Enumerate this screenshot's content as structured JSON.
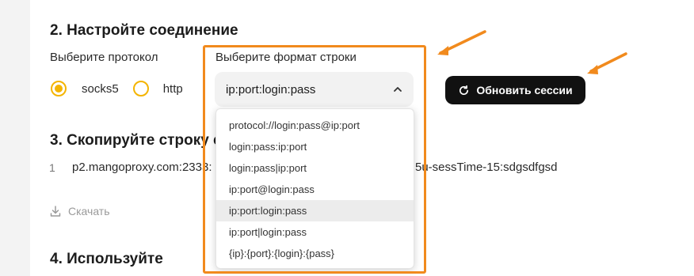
{
  "section2": {
    "title": "2. Настройте соединение",
    "protocol_label": "Выберите протокол",
    "format_label": "Выберите формат строки",
    "protocols": [
      {
        "label": "socks5",
        "selected": true
      },
      {
        "label": "http",
        "selected": false
      }
    ],
    "format_value": "ip:port:login:pass",
    "refresh_label": "Обновить сессии"
  },
  "section3": {
    "title": "3. Скопируйте строку с",
    "line_number": "1",
    "line_left": "p2.mangoproxy.com:2333:",
    "line_right": "5u-sessTime-15:sdgsdfgsd",
    "download_label": "Скачать"
  },
  "section4": {
    "title": "4. Используйте"
  },
  "dropdown": {
    "options": [
      {
        "label": "protocol://login:pass@ip:port",
        "selected": false
      },
      {
        "label": "login:pass:ip:port",
        "selected": false
      },
      {
        "label": "login:pass|ip:port",
        "selected": false
      },
      {
        "label": "ip:port@login:pass",
        "selected": false
      },
      {
        "label": "ip:port:login:pass",
        "selected": true
      },
      {
        "label": "ip:port|login:pass",
        "selected": false
      },
      {
        "label": "{ip}:{port}:{login}:{pass}",
        "selected": false
      }
    ]
  },
  "colors": {
    "accent_radio": "#f4b400",
    "annotation_orange": "#f18a1d",
    "button_bg": "#111111"
  },
  "icons": [
    "chevron-up-icon",
    "refresh-icon",
    "download-icon",
    "annotation-arrow-icon"
  ]
}
